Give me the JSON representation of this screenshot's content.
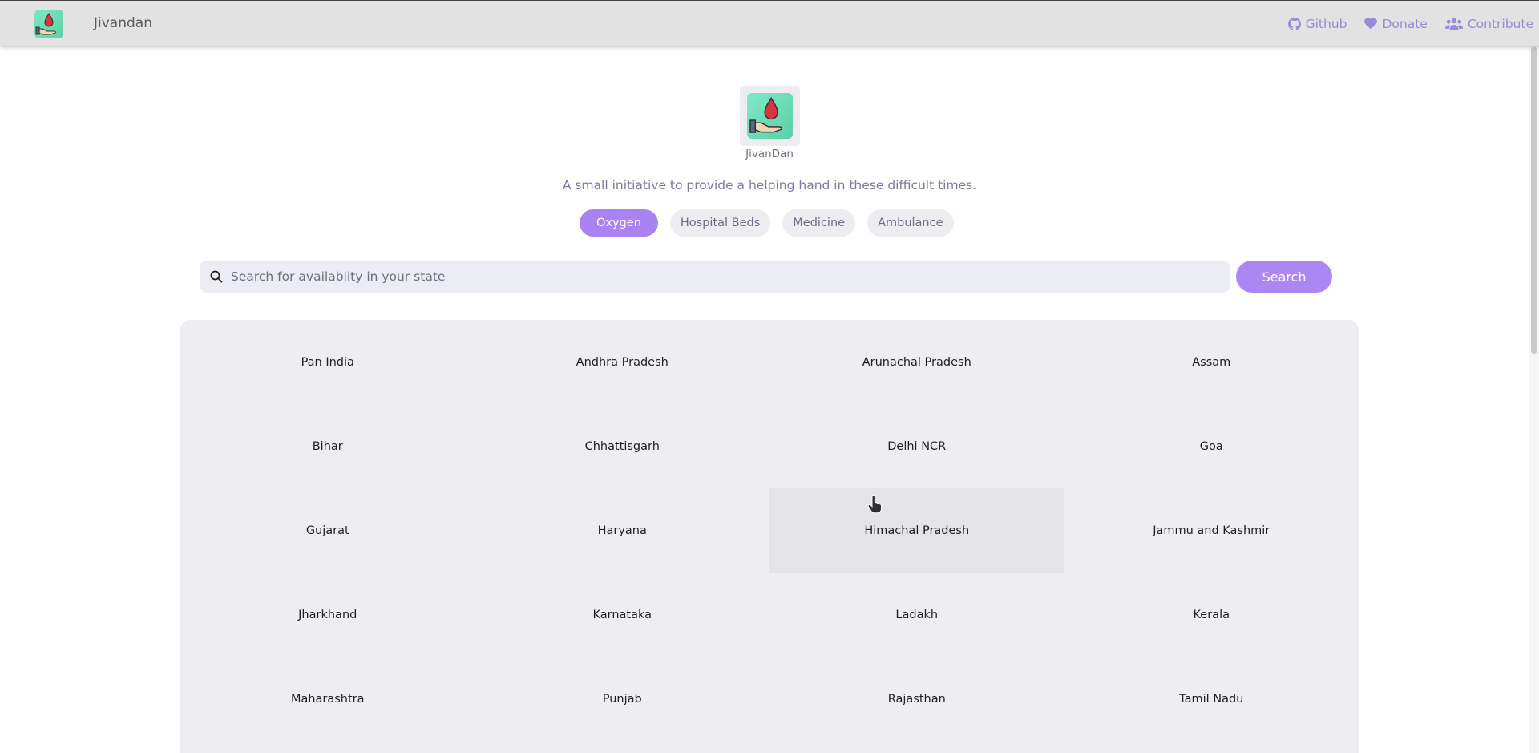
{
  "navbar": {
    "brand_name": "Jivandan",
    "links": [
      {
        "label": "Github",
        "icon": "github-icon"
      },
      {
        "label": "Donate",
        "icon": "heart-icon"
      },
      {
        "label": "Contribute",
        "icon": "users-icon"
      }
    ]
  },
  "hero": {
    "name": "JivanDan",
    "tagline": "A small initiative to provide a helping hand in these difficult times."
  },
  "categories": [
    {
      "label": "Oxygen",
      "active": true
    },
    {
      "label": "Hospital Beds",
      "active": false
    },
    {
      "label": "Medicine",
      "active": false
    },
    {
      "label": "Ambulance",
      "active": false
    }
  ],
  "search": {
    "placeholder": "Search for availablity in your state",
    "value": "",
    "button_label": "Search"
  },
  "states": [
    "Pan India",
    "Andhra Pradesh",
    "Arunachal Pradesh",
    "Assam",
    "Bihar",
    "Chhattisgarh",
    "Delhi NCR",
    "Goa",
    "Gujarat",
    "Haryana",
    "Himachal Pradesh",
    "Jammu and Kashmir",
    "Jharkhand",
    "Karnataka",
    "Ladakh",
    "Kerala",
    "Maharashtra",
    "Punjab",
    "Rajasthan",
    "Tamil Nadu"
  ],
  "hovered_state": "Himachal Pradesh",
  "colors": {
    "accent": "#ac86f3",
    "navbar_bg": "#e2e2e2",
    "nav_link": "#9a8ad8",
    "panel_bg": "#ededf2",
    "logo_green": "#6bdcb5",
    "blood_red": "#d8343f"
  }
}
